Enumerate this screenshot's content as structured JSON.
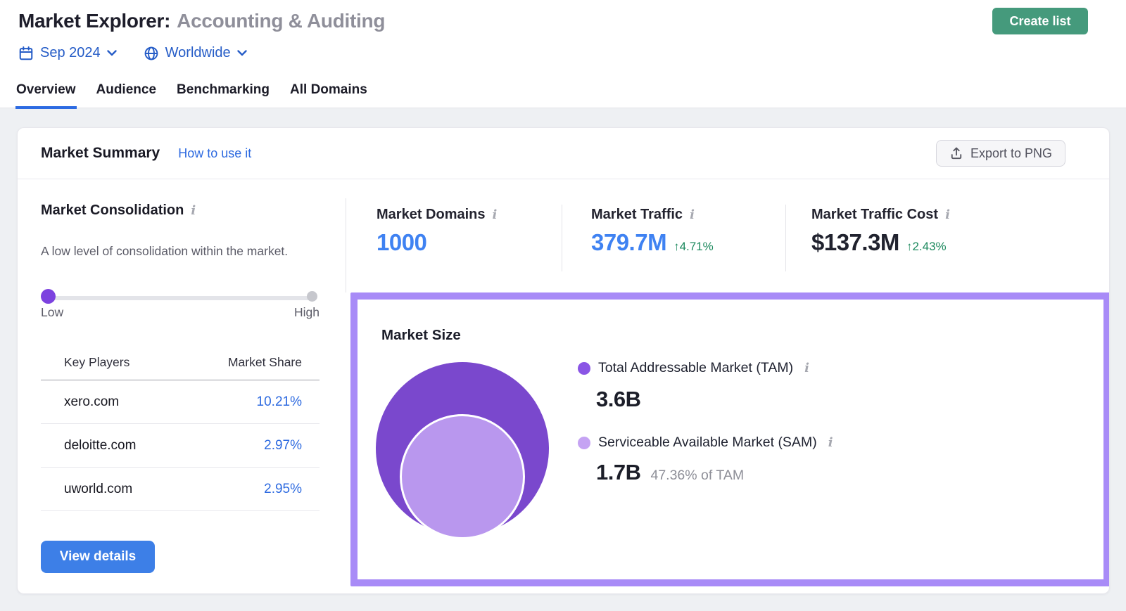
{
  "header": {
    "title_prefix": "Market Explorer:",
    "title_market": "Accounting & Auditing",
    "create_list_button": "Create list",
    "date_filter": "Sep 2024",
    "region_filter": "Worldwide",
    "tabs": [
      {
        "label": "Overview",
        "active": true
      },
      {
        "label": "Audience",
        "active": false
      },
      {
        "label": "Benchmarking",
        "active": false
      },
      {
        "label": "All Domains",
        "active": false
      }
    ]
  },
  "market_summary": {
    "title": "Market Summary",
    "help_link": "How to use it",
    "export_button": "Export to PNG"
  },
  "consolidation": {
    "title": "Market Consolidation",
    "description": "A low level of consolidation within the market.",
    "slider": {
      "position": "low",
      "low_label": "Low",
      "high_label": "High"
    },
    "table": {
      "col_domain": "Key Players",
      "col_share": "Market Share",
      "rows": [
        {
          "domain": "xero.com",
          "share": "10.21%"
        },
        {
          "domain": "deloitte.com",
          "share": "2.97%"
        },
        {
          "domain": "uworld.com",
          "share": "2.95%"
        }
      ]
    },
    "view_details_button": "View details"
  },
  "stats": [
    {
      "label": "Market Domains",
      "value": "1000"
    },
    {
      "label": "Market Traffic",
      "value": "379.7M",
      "change": "↑4.71%"
    },
    {
      "label": "Market Traffic Cost",
      "value": "$137.3M",
      "change": "↑2.43%"
    }
  ],
  "market_size": {
    "title": "Market Size",
    "tam_label": "Total Addressable Market (TAM)",
    "tam_value": "3.6B",
    "sam_label": "Serviceable Available Market (SAM)",
    "sam_value": "1.7B",
    "sam_percent": "47.36% of TAM"
  },
  "chart_data": {
    "type": "pie",
    "variant": "nested-circles",
    "title": "Market Size",
    "series": [
      {
        "name": "Total Addressable Market (TAM)",
        "value": 3600000000,
        "label": "3.6B",
        "color": "#7a48cd"
      },
      {
        "name": "Serviceable Available Market (SAM)",
        "value": 1700000000,
        "label": "1.7B",
        "percent_of_tam": 47.36,
        "color": "#b997ee"
      }
    ]
  },
  "icons": {
    "date-filter": "calendar-icon",
    "region-filter": "globe-icon",
    "filter-expand": "chevron-down-icon",
    "help": "info-icon (italic i)",
    "export": "upload-icon (arrow up from tray)"
  },
  "colors": {
    "accent_blue": "#2d6ae0",
    "filter_blue": "#255cc7",
    "value_blue": "#3f82f2",
    "positive_green": "#1e8a5f",
    "create_list_green": "#459a7c",
    "view_details_blue": "#3d7fe7",
    "highlight_purple": "#a88bf7",
    "tam_purple": "#7a48cd",
    "sam_purple": "#b997ee",
    "slider_purple": "#7c42df",
    "page_background": "#eef0f3"
  }
}
